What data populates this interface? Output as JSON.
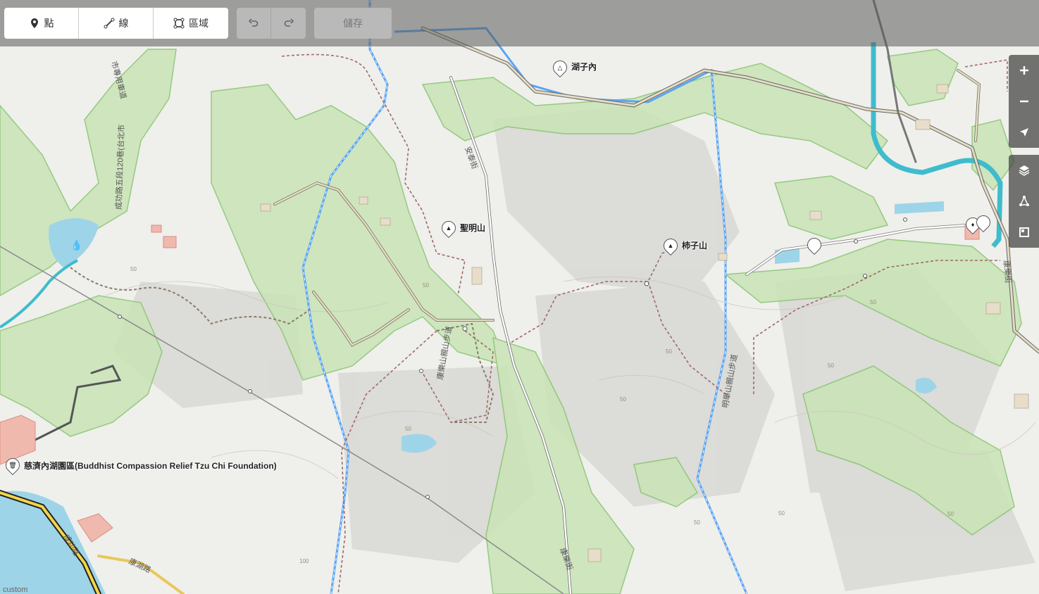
{
  "toolbar": {
    "point_label": "點",
    "line_label": "線",
    "area_label": "區域",
    "save_label": "儲存"
  },
  "map": {
    "places": [
      {
        "id": "huzinei",
        "name": "湖子內",
        "icon": "triangle-outline-icon"
      },
      {
        "id": "shengmingshan",
        "name": "聖明山",
        "icon": "peak-icon"
      },
      {
        "id": "shizishan",
        "name": "柿子山",
        "icon": "peak-icon"
      },
      {
        "id": "tzuchi",
        "name": "慈濟內湖園區(Buddhist Compassion Relief Tzu Chi Foundation)",
        "icon": "bin-icon"
      }
    ],
    "roads": [
      "成功路五段120巷(台北市",
      "市專用車道",
      "安泰街",
      "康樂街",
      "康湖路",
      "明舉山親山步道",
      "康樂山親山步道",
      "成功路",
      "康樂街"
    ],
    "contour_labels": [
      "50",
      "100"
    ],
    "attribution": "custom"
  },
  "colors": {
    "green_area": "#c7e3b4",
    "green_outline": "#7cc165",
    "water": "#8fd0e6",
    "trail": "#a06969",
    "admin_line": "#5aa4f5"
  }
}
